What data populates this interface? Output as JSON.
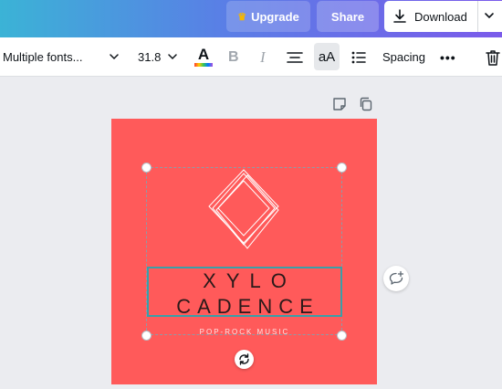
{
  "header": {
    "upgrade_label": "Upgrade",
    "share_label": "Share",
    "download_label": "Download"
  },
  "toolbar": {
    "font_family": "Multiple fonts...",
    "font_size": "31.8",
    "text_color_letter": "A",
    "bold_glyph": "B",
    "italic_glyph": "I",
    "case_label": "aA",
    "spacing_label": "Spacing",
    "more_label": "•••"
  },
  "design": {
    "background_color": "#ff5a5a",
    "title_line1": "XYLO",
    "title_line2": "CADENCE",
    "subtitle": "POP-ROCK MUSIC"
  },
  "colors": {
    "accent": "#7b5bea",
    "selection_border": "#3a9fa8"
  },
  "icons": {
    "upgrade": "crown-icon",
    "download": "download-icon",
    "align": "align-center-icon",
    "list": "bullet-list-icon",
    "trash": "trash-icon",
    "note": "note-icon",
    "copy": "copy-icon",
    "rotate": "rotate-icon",
    "comment": "add-comment-icon"
  }
}
